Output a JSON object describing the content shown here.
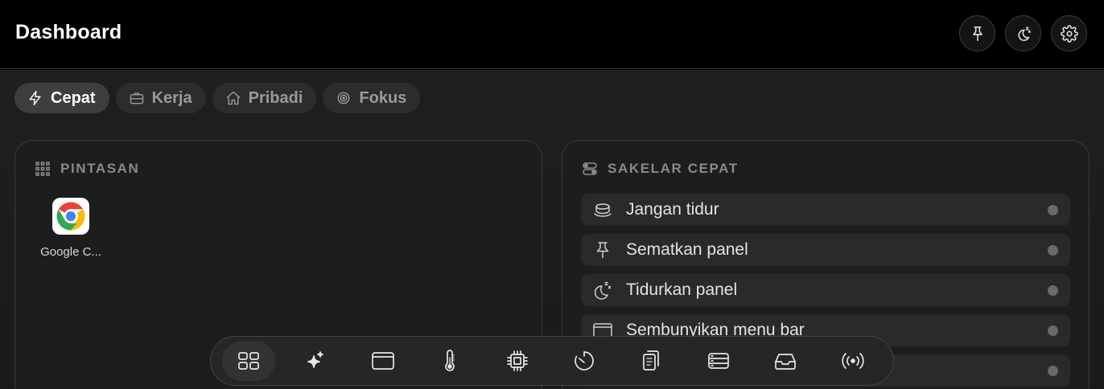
{
  "header": {
    "title": "Dashboard",
    "buttons": [
      {
        "icon": "pin-icon"
      },
      {
        "icon": "sleep-moon-icon"
      },
      {
        "icon": "gear-icon"
      }
    ]
  },
  "tabs": [
    {
      "label": "Cepat",
      "icon": "bolt-icon",
      "active": true
    },
    {
      "label": "Kerja",
      "icon": "briefcase-icon",
      "active": false
    },
    {
      "label": "Pribadi",
      "icon": "home-icon",
      "active": false
    },
    {
      "label": "Fokus",
      "icon": "target-icon",
      "active": false
    }
  ],
  "shortcuts_card": {
    "title": "PINTASAN",
    "icon": "grid-dots-icon",
    "items": [
      {
        "label": "Google C...",
        "icon": "chrome-icon"
      }
    ]
  },
  "toggles_card": {
    "title": "SAKELAR CEPAT",
    "icon": "toggles-icon",
    "items": [
      {
        "label": "Jangan tidur",
        "icon": "coffee-cup-icon",
        "on": false
      },
      {
        "label": "Sematkan panel",
        "icon": "pin-icon",
        "on": false
      },
      {
        "label": "Tidurkan panel",
        "icon": "sleep-moon-icon",
        "on": false
      },
      {
        "label": "Sembunyikan menu bar",
        "icon": "window-icon",
        "on": false
      },
      {
        "label": "",
        "icon": "partially-hidden-icon",
        "on": false
      }
    ]
  },
  "dock": {
    "items": [
      {
        "icon": "grid-icon",
        "active": true
      },
      {
        "icon": "sparkles-icon",
        "active": false
      },
      {
        "icon": "window-icon",
        "active": false
      },
      {
        "icon": "thermometer-icon",
        "active": false
      },
      {
        "icon": "cpu-chip-icon",
        "active": false
      },
      {
        "icon": "timer-icon",
        "active": false
      },
      {
        "icon": "clipboard-icon",
        "active": false
      },
      {
        "icon": "server-stack-icon",
        "active": false
      },
      {
        "icon": "inbox-tray-icon",
        "active": false
      },
      {
        "icon": "broadcast-icon",
        "active": false
      }
    ]
  },
  "colors": {
    "background": "#000000",
    "panel": "#1d1d1d",
    "toggle_off_dot": "#6a6a6a",
    "chrome_red": "#ea4335",
    "chrome_yellow": "#fbbc05",
    "chrome_green": "#34a853",
    "chrome_blue": "#4285f4"
  }
}
